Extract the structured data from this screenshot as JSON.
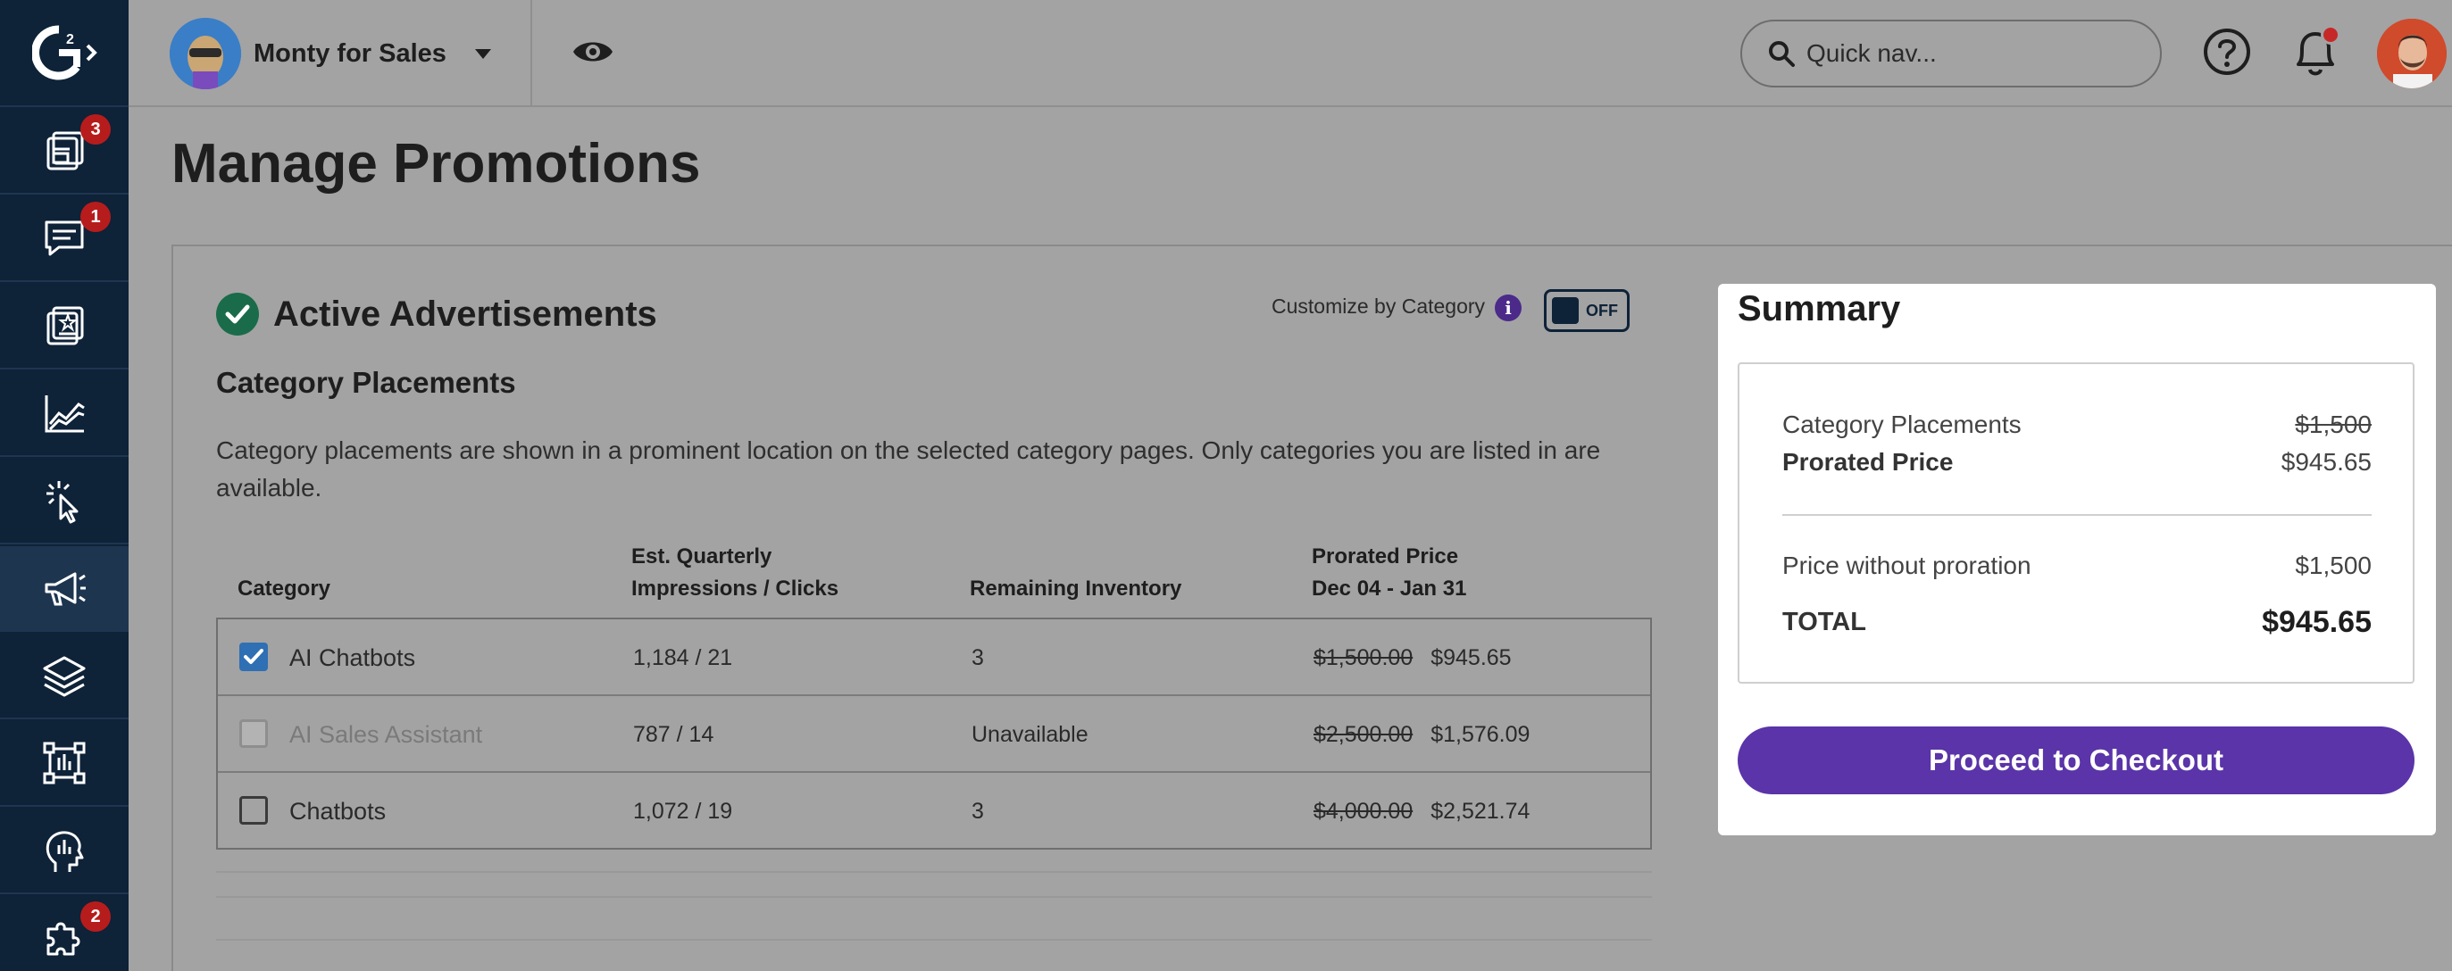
{
  "topbar": {
    "account_name": "Monty for Sales",
    "search_placeholder": "Quick nav..."
  },
  "sidebar": {
    "items": [
      {
        "icon": "reviews-icon",
        "badge": "3"
      },
      {
        "icon": "chat-icon",
        "badge": "1"
      },
      {
        "icon": "profile-icon",
        "badge": ""
      },
      {
        "icon": "analytics-icon",
        "badge": ""
      },
      {
        "icon": "buyer-intent-icon",
        "badge": ""
      },
      {
        "icon": "megaphone-icon",
        "badge": "",
        "active": true
      },
      {
        "icon": "layers-icon",
        "badge": ""
      },
      {
        "icon": "frame-icon",
        "badge": ""
      },
      {
        "icon": "insights-icon",
        "badge": ""
      },
      {
        "icon": "integrations-icon",
        "badge": "2"
      }
    ]
  },
  "page": {
    "title": "Manage Promotions"
  },
  "section": {
    "title": "Active Advertisements",
    "customize_label": "Customize by Category",
    "toggle_label": "OFF",
    "subtitle": "Category Placements",
    "description": "Category placements are shown in a prominent location on the selected category pages. Only categories you are listed in are available."
  },
  "table": {
    "headers": {
      "category": "Category",
      "impressions_line1": "Est. Quarterly",
      "impressions_line2": "Impressions / Clicks",
      "inventory": "Remaining Inventory",
      "price_line1": "Prorated Price",
      "price_line2": "Dec 04 - Jan 31"
    },
    "rows": [
      {
        "category": "AI Chatbots",
        "checked": true,
        "disabled": false,
        "impressions": "1,184 / 21",
        "inventory": "3",
        "original_price": "$1,500.00",
        "prorated_price": "$945.65"
      },
      {
        "category": "AI Sales Assistant",
        "checked": false,
        "disabled": true,
        "impressions": "787 / 14",
        "inventory": "Unavailable",
        "original_price": "$2,500.00",
        "prorated_price": "$1,576.09"
      },
      {
        "category": "Chatbots",
        "checked": false,
        "disabled": false,
        "impressions": "1,072 / 19",
        "inventory": "3",
        "original_price": "$4,000.00",
        "prorated_price": "$2,521.74"
      }
    ]
  },
  "summary": {
    "title": "Summary",
    "line_label": "Category Placements",
    "line_original": "$1,500",
    "prorated_label": "Prorated Price",
    "prorated_value": "$945.65",
    "without_label": "Price without proration",
    "without_value": "$1,500",
    "total_label": "TOTAL",
    "total_value": "$945.65",
    "checkout_label": "Proceed to Checkout"
  },
  "colors": {
    "sidebar_bg": "#0e2238",
    "accent_purple": "#5a34a8",
    "success_green": "#1a6b4a",
    "badge_red": "#b71c1c",
    "checkbox_blue": "#2f6fb3"
  }
}
